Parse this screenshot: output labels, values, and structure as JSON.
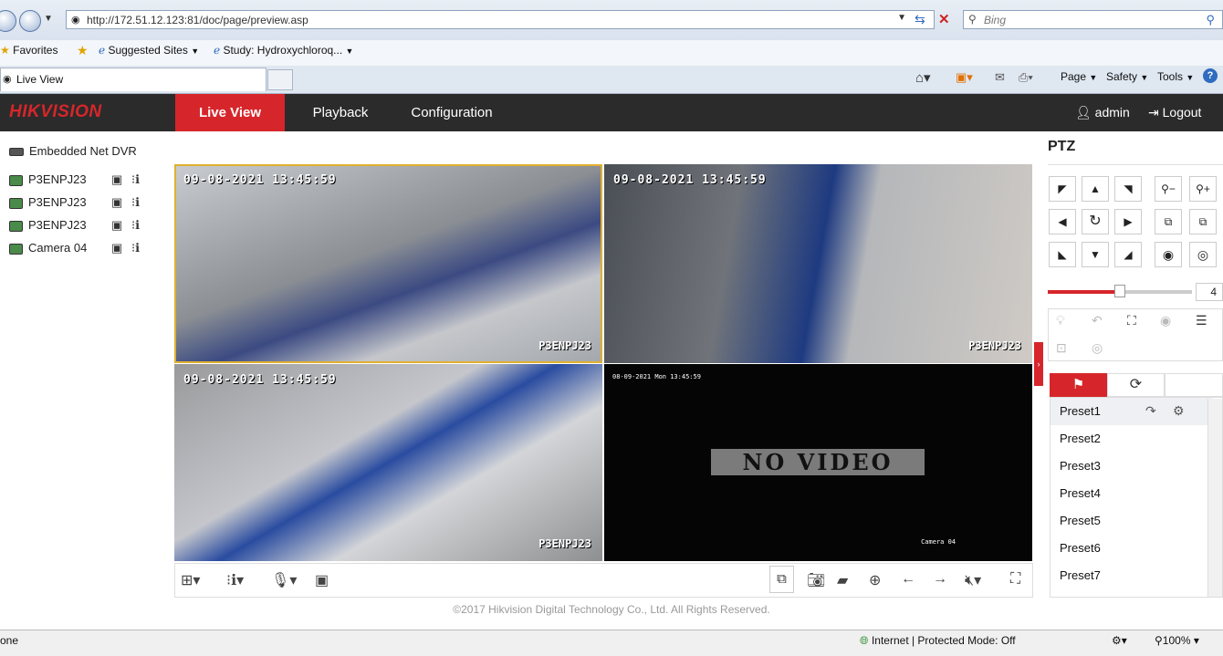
{
  "browser": {
    "url": "http://172.51.12.123:81/doc/page/preview.asp",
    "search_placeholder": "Bing",
    "favorites": "Favorites",
    "suggested_sites": "Suggested Sites",
    "study_link": "Study: Hydroxychloroq...",
    "tab_title": "Live View",
    "cmd_page": "Page",
    "cmd_safety": "Safety",
    "cmd_tools": "Tools",
    "status_left": "one",
    "status_zone": "Internet | Protected Mode: Off",
    "zoom": "100%"
  },
  "app": {
    "logo": "HIKVISION",
    "menu": [
      "Live View",
      "Playback",
      "Configuration"
    ],
    "user": "admin",
    "logout": "Logout",
    "copyright": "©2017 Hikvision Digital Technology Co., Ltd. All Rights Reserved."
  },
  "tree": {
    "root": "Embedded Net DVR",
    "cameras": [
      "P3ENPJ23",
      "P3ENPJ23",
      "P3ENPJ23",
      "Camera 04"
    ]
  },
  "video": {
    "panes": [
      {
        "timestamp": "09-08-2021 13:45:59",
        "name": "P3ENPJ23"
      },
      {
        "timestamp": "09-08-2021 13:45:59",
        "name": "P3ENPJ23"
      },
      {
        "timestamp": "09-08-2021 13:45:59",
        "name": "P3ENPJ23"
      },
      {
        "timestamp": "08-09-2021 Mon 13:45:59",
        "name": "Camera 04"
      }
    ],
    "no_video": "NO VIDEO"
  },
  "ptz": {
    "title": "PTZ",
    "speed": "4",
    "speed_fraction": 0.5,
    "presets": [
      "Preset1",
      "Preset2",
      "Preset3",
      "Preset4",
      "Preset5",
      "Preset6",
      "Preset7"
    ]
  },
  "colors": {
    "accent": "#d6262b",
    "header": "#2b2b2b"
  }
}
